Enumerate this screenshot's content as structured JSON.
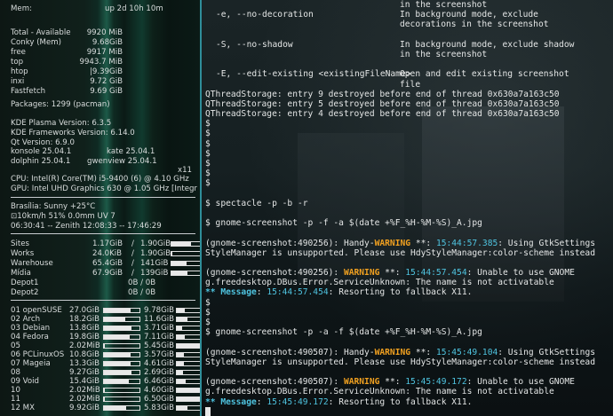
{
  "conky": {
    "mem_label": "Mem:",
    "uptime": "up  2d 10h 10m",
    "mem": [
      {
        "label": "Total - Available",
        "value": "9920 MiB"
      },
      {
        "label": "Conky (Mem)",
        "value": "9.68GiB"
      },
      {
        "label": "free",
        "value": "9917   MiB"
      },
      {
        "label": "top",
        "value": "9943.7   MiB"
      },
      {
        "label": "htop",
        "value": "|9.39GiB"
      },
      {
        "label": "inxi",
        "value": "9.72 GiB"
      },
      {
        "label": "Fastfetch",
        "value": "9.69 GiB"
      }
    ],
    "packages": "Packages: 1299 (pacman)",
    "kde_plasma": "KDE Plasma Version: 6.3.5",
    "kde_frameworks": "KDE Frameworks Version: 6.14.0",
    "qt": "Qt Version: 6.9.0",
    "konsole": "konsole 25.04.1",
    "kate": "kate 25.04.1",
    "dolphin": "dolphin 25.04.1",
    "gwenview": "gwenview 25.04.1",
    "x11": "x11",
    "cpu": "CPU: Intel(R) Core(TM) i5-9400 (6) @ 4.10 GHz",
    "gpu": "GPU: Intel UHD Graphics 630 @ 1.05 GHz [Integr",
    "weather_line1": "Brasília:   Sunny  +25°C",
    "weather_line2": "⊡10km/h   51%   0.0mm   UV 7",
    "weather_line3": "06:30:41 -- Zenith 12:08:33 -- 17:46:29",
    "net": [
      {
        "name": "Sites",
        "used": "1.17GiB",
        "total": "1.90GiB",
        "fill": 0.62
      },
      {
        "name": "Works",
        "used": "24.0KiB",
        "total": "1.90GiB",
        "fill": 0.02
      },
      {
        "name": "Warehouse",
        "used": "65.4GiB",
        "total": "141GiB",
        "fill": 0.46
      },
      {
        "name": "Mídia",
        "used": "67.9GiB",
        "total": "139GiB",
        "fill": 0.49
      },
      {
        "name": "Depot1",
        "used": "",
        "total": "0B  /  0B",
        "fill": 0
      },
      {
        "name": "Depot2",
        "used": "",
        "total": "0B  /  0B",
        "fill": 0
      }
    ],
    "disks": [
      {
        "name": "01 openSUSE",
        "used": "27.0GiB",
        "free": "9.78GiB",
        "u": 0.75,
        "f": 0.28
      },
      {
        "name": "02 Arch",
        "used": "18.2GiB",
        "free": "11.6GiB",
        "u": 0.6,
        "f": 0.38
      },
      {
        "name": "03 Debian",
        "used": "13.8GiB",
        "free": "3.71GiB",
        "u": 0.78,
        "f": 0.2
      },
      {
        "name": "04 Fedora",
        "used": "19.8GiB",
        "free": "7.11GiB",
        "u": 0.72,
        "f": 0.27
      },
      {
        "name": "05",
        "used": "2.02MiB",
        "free": "5.45GiB",
        "u": 0.02,
        "f": 0.98
      },
      {
        "name": "06 PCLinuxOS",
        "used": "10.8GiB",
        "free": "3.57GiB",
        "u": 0.74,
        "f": 0.25
      },
      {
        "name": "07 Mageia",
        "used": "13.3GiB",
        "free": "4.61GiB",
        "u": 0.74,
        "f": 0.26
      },
      {
        "name": "08",
        "used": "9.27GiB",
        "free": "2.69GiB",
        "u": 0.77,
        "f": 0.22
      },
      {
        "name": "09 Void",
        "used": "15.4GiB",
        "free": "6.46GiB",
        "u": 0.7,
        "f": 0.3
      },
      {
        "name": "10",
        "used": "2.02MiB",
        "free": "4.60GiB",
        "u": 0.02,
        "f": 0.98
      },
      {
        "name": "11",
        "used": "2.02MiB",
        "free": "6.50GiB",
        "u": 0.02,
        "f": 0.98
      },
      {
        "name": "12 MX",
        "used": "9.92GiB",
        "free": "5.83GiB",
        "u": 0.63,
        "f": 0.37
      }
    ]
  },
  "terminal": {
    "top": [
      {
        "left": "",
        "right": "in the screenshot"
      },
      {
        "left": "-e, --no-decoration",
        "right": "In background mode, exclude"
      },
      {
        "left": "",
        "right": "decorations in the screenshot"
      },
      {
        "left": "-S, --no-shadow",
        "right": "In background mode, exclude shadow"
      },
      {
        "left": "",
        "right": "in the screenshot"
      },
      {
        "left": "-E, --edit-existing <existingFileName>",
        "right": "Open and edit existing screenshot"
      },
      {
        "left": "",
        "right": "file"
      }
    ],
    "qthread": [
      "QThreadStorage: entry 9 destroyed before end of thread 0x630a7a163c50",
      "QThreadStorage: entry 5 destroyed before end of thread 0x630a7a163c50",
      "QThreadStorage: entry 4 destroyed before end of thread 0x630a7a163c50"
    ],
    "prompt": "$",
    "cmd1": "$ spectacle -p -b -r",
    "cmd2": "$ gnome-screenshot -p -f -a $(date +%F_%H-%M-%S)_A.jpg",
    "cmd3": "$ gnome-screenshot -p -a -f $(date +%F_%H-%M-%S)_A.jpg",
    "run1": {
      "pid": "(gnome-screenshot:490256): Handy-",
      "pid2": "(gnome-screenshot:490256): ",
      "warn": "WARNING",
      "stars": " **: ",
      "ts1": "15:44:57.385",
      "txt1": ": Using GtkSettings",
      "line2": "StyleManager is unsupported. Please use HdyStyleManager:color-scheme instead",
      "ts2": "15:44:57.454",
      "txt2": ": Unable to use GNOME",
      "line4": "g.freedesktop.DBus.Error.ServiceUnknown: The name is not activatable",
      "msg_pre": "** ",
      "msg": "Message",
      "msg_mid": ": ",
      "ts3": "15:44:57.454",
      "txt3": ": Resorting to fallback X11."
    },
    "run2": {
      "pid": "(gnome-screenshot:490507): Handy-",
      "pid2": "(gnome-screenshot:490507): ",
      "ts1": "15:45:49.104",
      "txt1": ": Using GtkSettings",
      "line2": "StyleManager is unsupported. Please use HdyStyleManager:color-scheme instead",
      "ts2": "15:45:49.172",
      "txt2": ": Unable to use GNOME",
      "line4": "g.freedesktop.DBus.Error.ServiceUnknown: The name is not activatable",
      "ts3": "15:45:49.172",
      "txt3": ": Resorting to fallback X11."
    },
    "colors": {
      "warning": "#f0a020",
      "timestamp": "#4fc4e0",
      "accent": "#2f8e9a"
    }
  }
}
